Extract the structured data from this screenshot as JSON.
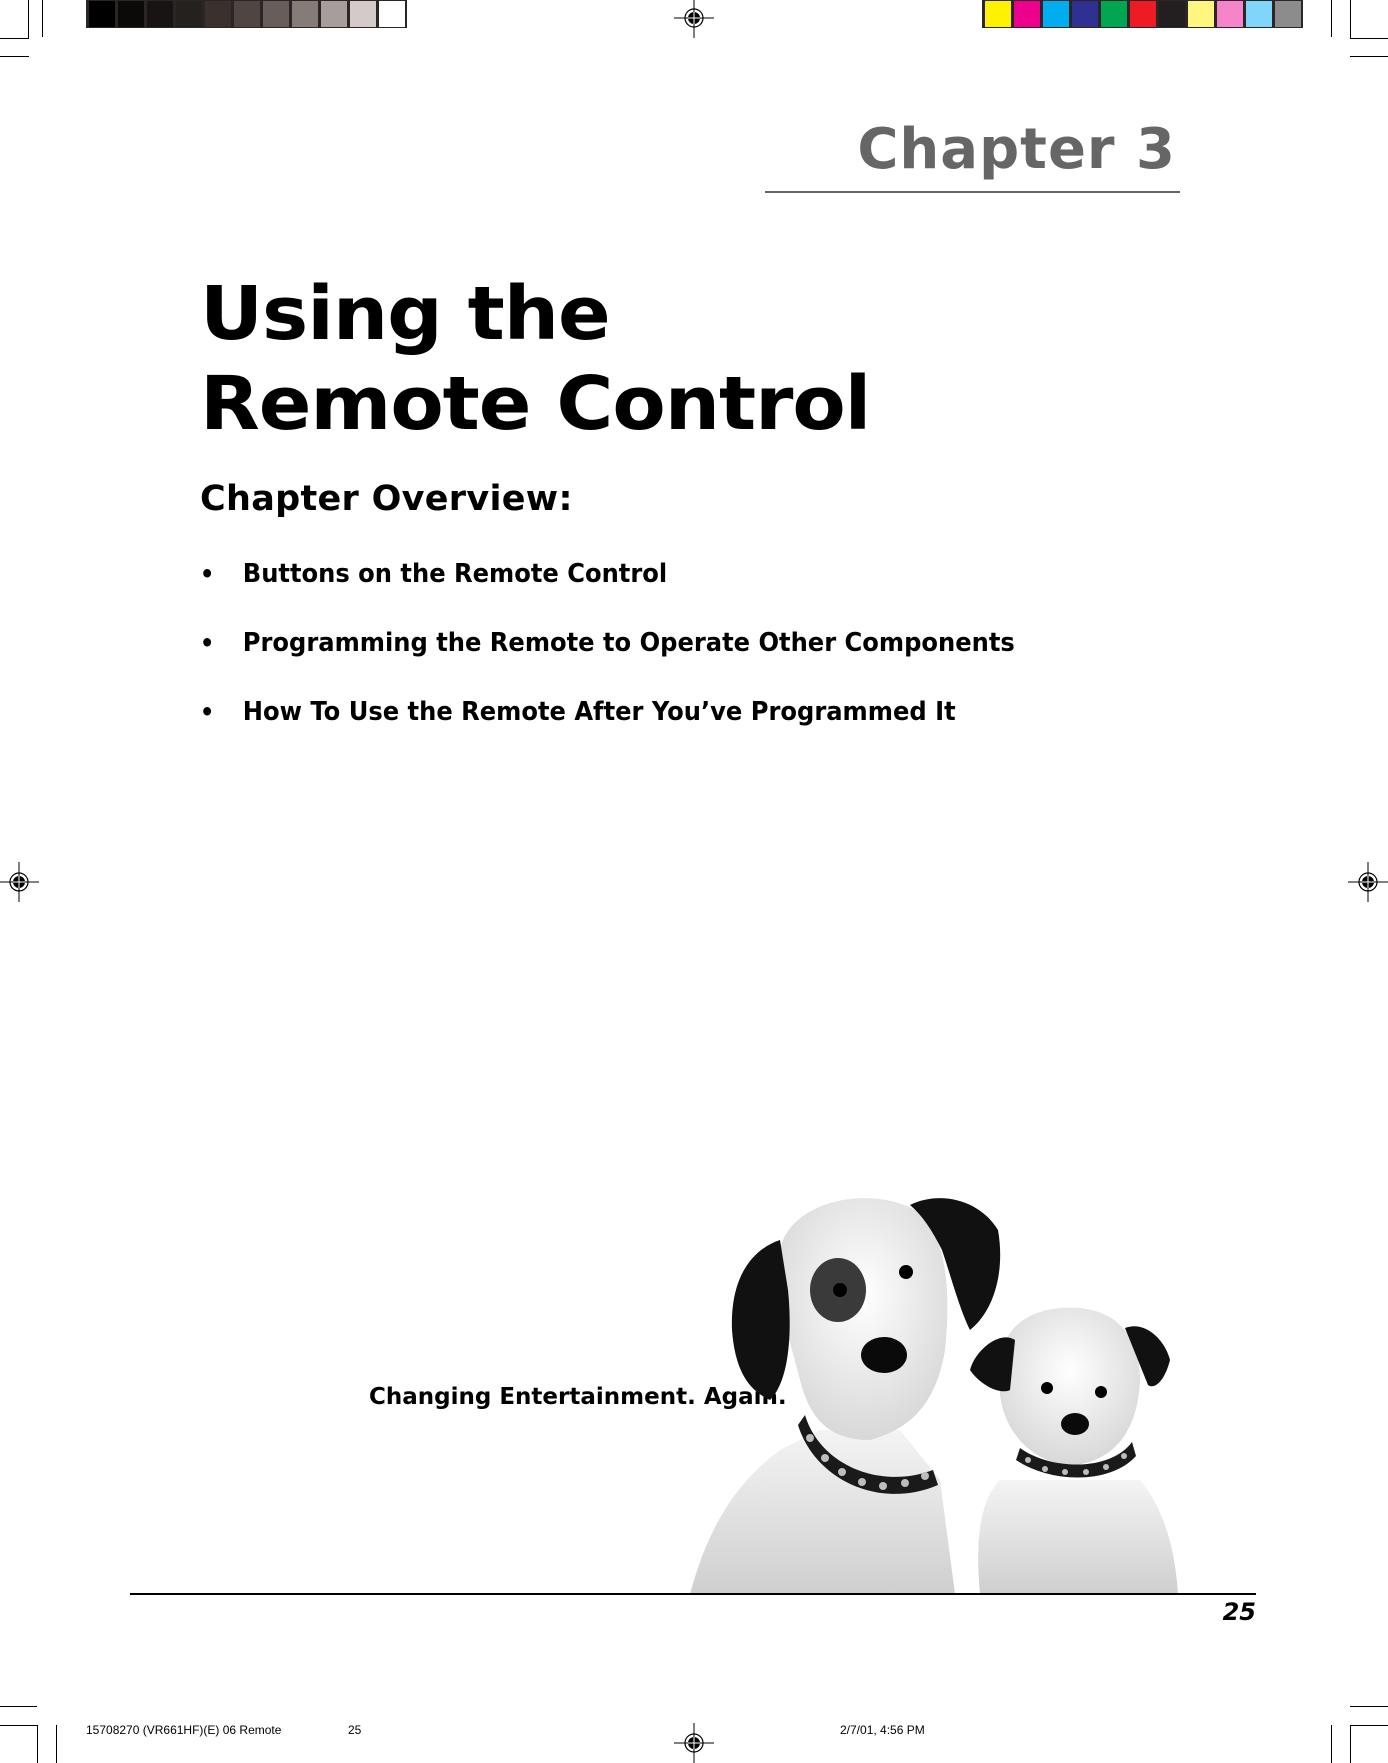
{
  "print_marks": {
    "grayscale_swatches": [
      "#000000",
      "#0b0a09",
      "#171413",
      "#25211f",
      "#3a302e",
      "#4f4644",
      "#675d5a",
      "#857b77",
      "#a79d9a",
      "#d3cbc9",
      "#ffffff"
    ],
    "color_swatches": [
      "#fff200",
      "#ec008c",
      "#00aeef",
      "#2e3192",
      "#00a651",
      "#ed1c24",
      "#231f20",
      "#fff67f",
      "#f584c8",
      "#7fd6f9",
      "#8c8c8c"
    ],
    "slug": {
      "job": "15708270 (VR661HF)(E) 06 Remote",
      "page": "25",
      "timestamp": "2/7/01, 4:56 PM"
    }
  },
  "header": {
    "chapter_label": "Chapter 3",
    "accent_color": "#666666"
  },
  "title": {
    "line1": "Using the",
    "line2": "Remote Control"
  },
  "overview": {
    "heading": "Chapter Overview:",
    "bullet_glyph": "•",
    "items": [
      "Buttons on the Remote Control",
      "Programming the Remote to Operate Other Components",
      "How To Use the Remote After You’ve Programmed It"
    ]
  },
  "branding": {
    "tagline": "Changing Entertainment. Again.",
    "image_alt": "Two terrier dogs (adult and puppy) with studded collars"
  },
  "footer": {
    "page_number": "25"
  }
}
